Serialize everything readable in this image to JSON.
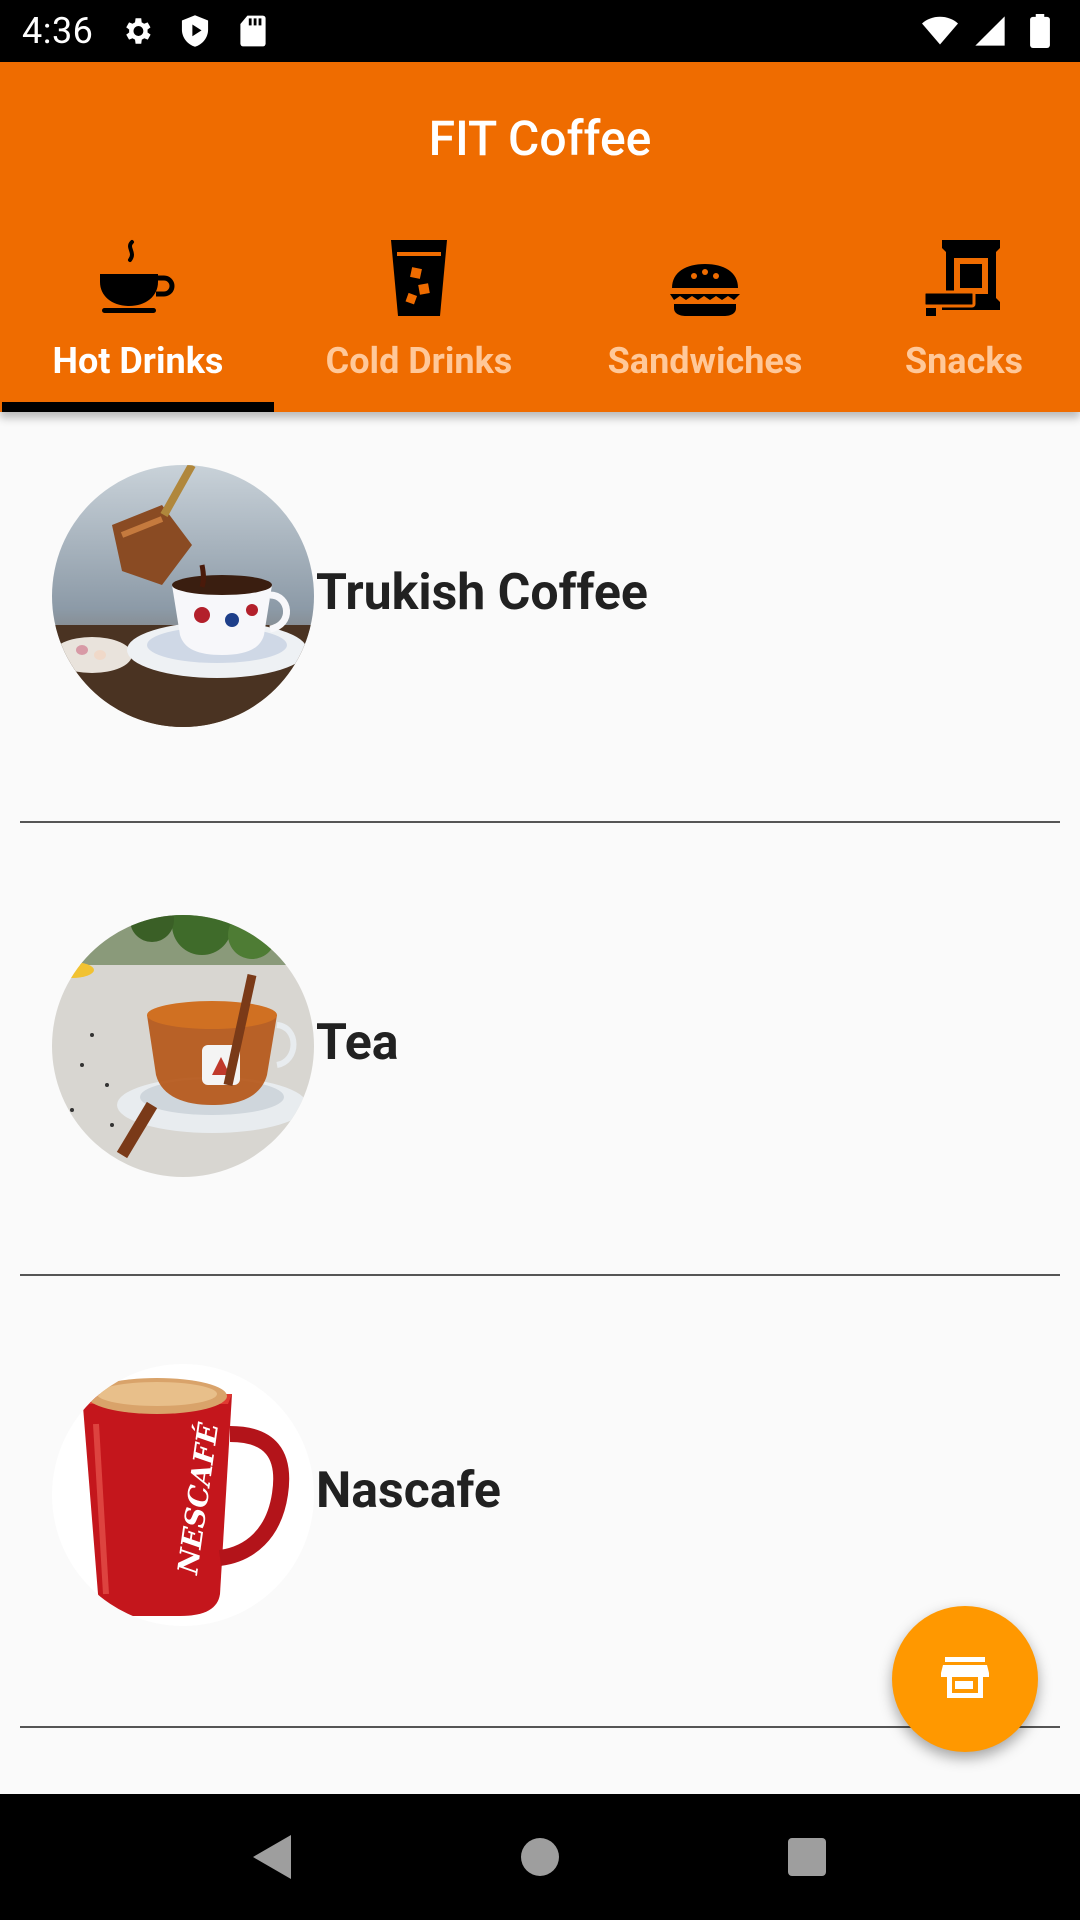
{
  "status_bar": {
    "time": "4:36",
    "left_icons": [
      "settings-icon",
      "play-protect-icon",
      "sd-card-icon"
    ],
    "right_icons": [
      "wifi-icon",
      "signal-icon",
      "battery-icon"
    ]
  },
  "app_bar": {
    "title": "FIT Coffee",
    "color": "#ef6c00"
  },
  "tabs": [
    {
      "label": "Hot Drinks",
      "icon": "hot-cup-icon",
      "active": true
    },
    {
      "label": "Cold Drinks",
      "icon": "iced-drink-icon",
      "active": false
    },
    {
      "label": "Sandwiches",
      "icon": "sandwich-icon",
      "active": false
    },
    {
      "label": "Snacks",
      "icon": "snack-bag-icon",
      "active": false
    }
  ],
  "items": [
    {
      "name": "Trukish Coffee",
      "image": "turkish-coffee-image"
    },
    {
      "name": "Tea",
      "image": "tea-image"
    },
    {
      "name": "Nascafe",
      "image": "nescafe-mug-image",
      "brand_text": "NESCAFÉ"
    }
  ],
  "fab": {
    "icon": "store-icon",
    "color": "#ff9800"
  },
  "nav_bar": {
    "buttons": [
      "back-icon",
      "home-icon",
      "recents-icon"
    ]
  }
}
